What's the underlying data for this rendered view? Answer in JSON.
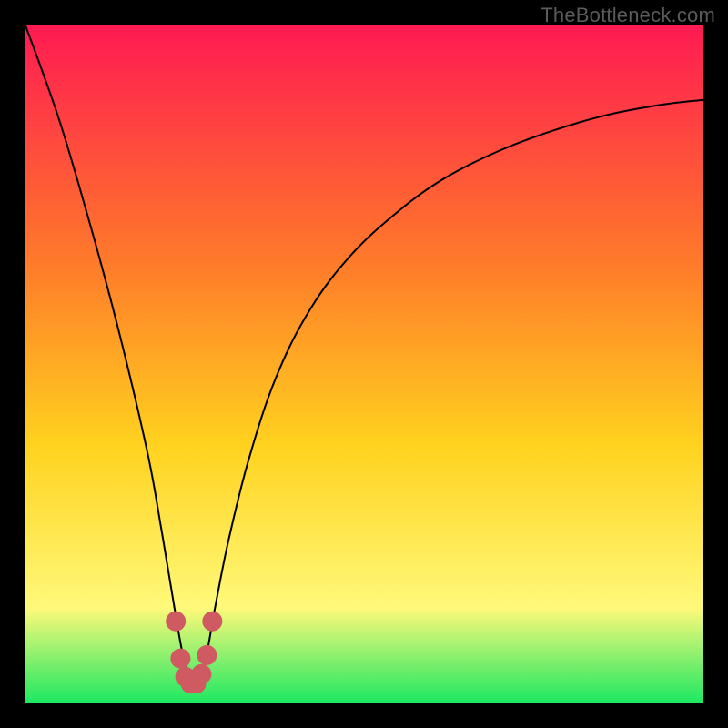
{
  "watermark": "TheBottleneck.com",
  "colors": {
    "frame": "#000000",
    "gradient_top": "#ff1a52",
    "gradient_mid1": "#ff7a2a",
    "gradient_mid2": "#ffd21e",
    "gradient_mid3": "#fff97a",
    "gradient_bottom": "#1ee862",
    "curve": "#000000",
    "marker": "#cf5a61"
  },
  "chart_data": {
    "type": "line",
    "title": "",
    "xlabel": "",
    "ylabel": "",
    "xlim": [
      0,
      100
    ],
    "ylim": [
      0,
      100
    ],
    "series": [
      {
        "name": "bottleneck-curve",
        "x": [
          0,
          5,
          10,
          14,
          18,
          20,
          22,
          23.5,
          25,
          26.5,
          28,
          30,
          33,
          37,
          42,
          48,
          55,
          62,
          70,
          78,
          86,
          94,
          100
        ],
        "y": [
          100,
          86,
          69,
          54,
          37,
          26,
          14,
          6,
          3,
          6,
          14,
          24,
          36,
          48,
          58,
          66,
          72.5,
          77.5,
          81.5,
          84.5,
          86.8,
          88.3,
          89
        ]
      }
    ],
    "markers": {
      "name": "valley-highlight",
      "x": [
        22.2,
        22.9,
        23.6,
        24.4,
        25.2,
        26.0,
        26.8,
        27.6
      ],
      "y": [
        12,
        6.5,
        3.8,
        2.8,
        2.8,
        4.2,
        7,
        12
      ]
    },
    "notes": "Values estimated from pixel positions relative to plot bounds; axes are unlabeled in the source image."
  }
}
